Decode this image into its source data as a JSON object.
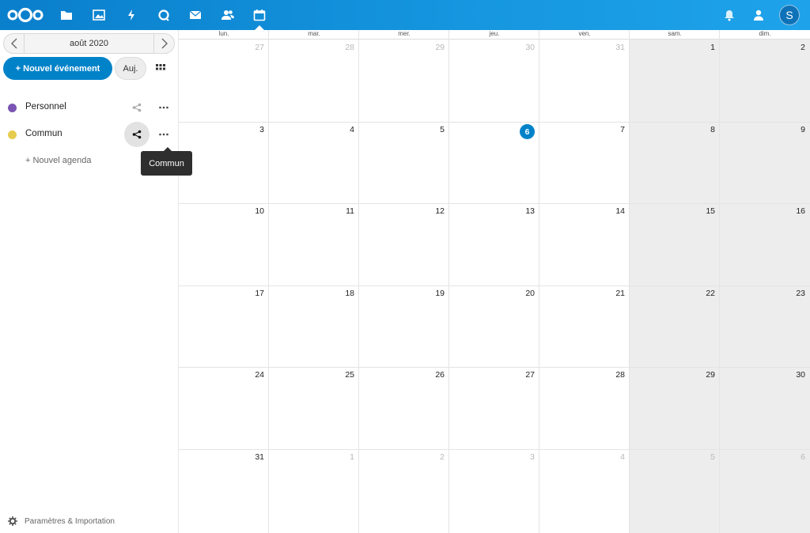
{
  "header": {
    "apps": [
      {
        "name": "files-icon"
      },
      {
        "name": "photos-icon"
      },
      {
        "name": "activity-icon"
      },
      {
        "name": "talk-icon"
      },
      {
        "name": "mail-icon"
      },
      {
        "name": "contacts-icon"
      },
      {
        "name": "calendar-icon",
        "active": true
      }
    ],
    "avatar_initial": "S"
  },
  "sidebar": {
    "month_label": "août 2020",
    "new_event_label": "+ Nouvel événement",
    "today_label": "Auj.",
    "calendars": [
      {
        "name": "Personnel",
        "color": "#7a55b3"
      },
      {
        "name": "Commun",
        "color": "#e6cc4e"
      }
    ],
    "new_calendar_label": "+ Nouvel agenda",
    "tooltip": "Commun",
    "settings_label": "Paramètres & Importation"
  },
  "calendar": {
    "weekdays": [
      "lun.",
      "mar.",
      "mer.",
      "jeu.",
      "ven.",
      "sam.",
      "dim."
    ],
    "weeks": [
      [
        {
          "d": "27",
          "o": true
        },
        {
          "d": "28",
          "o": true
        },
        {
          "d": "29",
          "o": true
        },
        {
          "d": "30",
          "o": true
        },
        {
          "d": "31",
          "o": true
        },
        {
          "d": "1"
        },
        {
          "d": "2"
        }
      ],
      [
        {
          "d": "3"
        },
        {
          "d": "4"
        },
        {
          "d": "5"
        },
        {
          "d": "6",
          "today": true
        },
        {
          "d": "7"
        },
        {
          "d": "8"
        },
        {
          "d": "9"
        }
      ],
      [
        {
          "d": "10"
        },
        {
          "d": "11"
        },
        {
          "d": "12"
        },
        {
          "d": "13"
        },
        {
          "d": "14"
        },
        {
          "d": "15"
        },
        {
          "d": "16"
        }
      ],
      [
        {
          "d": "17"
        },
        {
          "d": "18"
        },
        {
          "d": "19"
        },
        {
          "d": "20"
        },
        {
          "d": "21"
        },
        {
          "d": "22"
        },
        {
          "d": "23"
        }
      ],
      [
        {
          "d": "24"
        },
        {
          "d": "25"
        },
        {
          "d": "26"
        },
        {
          "d": "27"
        },
        {
          "d": "28"
        },
        {
          "d": "29"
        },
        {
          "d": "30"
        }
      ],
      [
        {
          "d": "31"
        },
        {
          "d": "1",
          "o": true
        },
        {
          "d": "2",
          "o": true
        },
        {
          "d": "3",
          "o": true
        },
        {
          "d": "4",
          "o": true
        },
        {
          "d": "5",
          "o": true
        },
        {
          "d": "6",
          "o": true
        }
      ]
    ],
    "accent_color": "#0082c9"
  }
}
